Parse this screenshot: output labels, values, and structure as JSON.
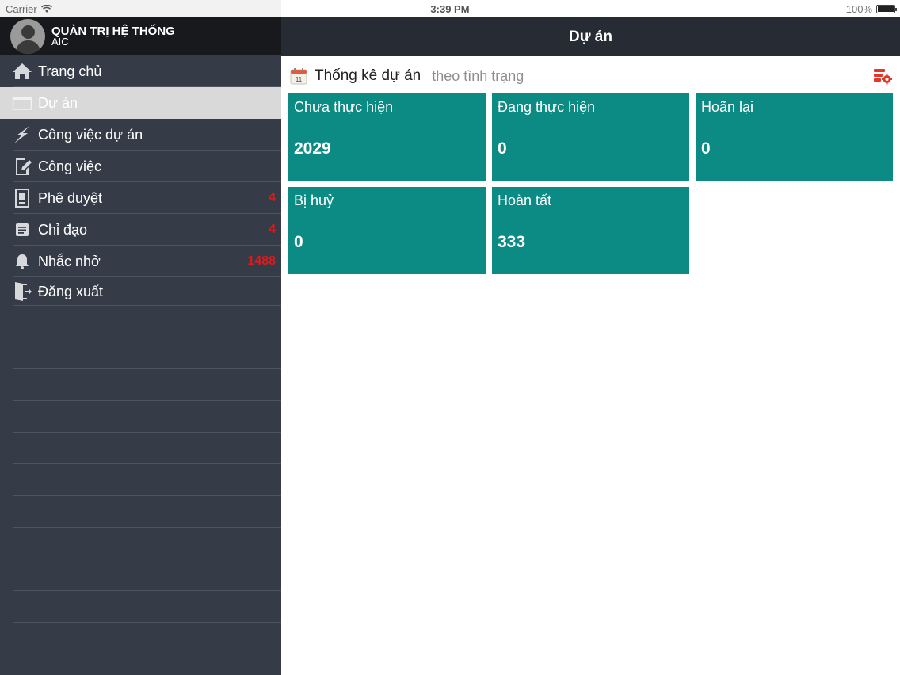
{
  "status_bar": {
    "carrier": "Carrier",
    "time": "3:39 PM",
    "battery": "100%"
  },
  "sidebar": {
    "user": {
      "name": "QUẢN TRỊ HỆ THỐNG",
      "org": "AIC"
    },
    "items": [
      {
        "label": "Trang chủ",
        "icon": "home-icon",
        "badge": ""
      },
      {
        "label": "Dự án",
        "icon": "window-icon",
        "badge": ""
      },
      {
        "label": "Công việc dự án",
        "icon": "lightning-icon",
        "badge": ""
      },
      {
        "label": "Công việc",
        "icon": "edit-document-icon",
        "badge": ""
      },
      {
        "label": "Phê duyệt",
        "icon": "approval-icon",
        "badge": "4"
      },
      {
        "label": "Chỉ đạo",
        "icon": "list-icon",
        "badge": "4"
      },
      {
        "label": "Nhắc nhở",
        "icon": "bell-icon",
        "badge": "1488"
      },
      {
        "label": "Đăng xuất",
        "icon": "logout-door-icon",
        "badge": ""
      }
    ]
  },
  "navbar": {
    "title": "Dự án"
  },
  "stats": {
    "title": "Thống kê dự án",
    "subtitle": "theo tình trạng",
    "calendar_day": "11",
    "tiles": [
      {
        "label": "Chưa thực hiện",
        "value": "2029"
      },
      {
        "label": "Đang thực hiện",
        "value": "0"
      },
      {
        "label": "Hoãn lại",
        "value": "0"
      },
      {
        "label": "Bị huỷ",
        "value": "0"
      },
      {
        "label": "Hoàn tất",
        "value": "333"
      }
    ]
  },
  "colors": {
    "tile": "#0c8a84",
    "sidebar": "#353c48",
    "navbar": "#272b33",
    "badge": "#e0191b",
    "active_item": "#d9d9d9"
  }
}
